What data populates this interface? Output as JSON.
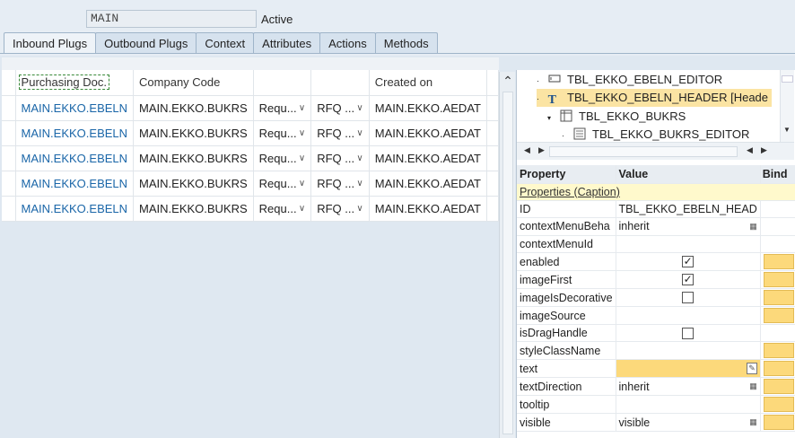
{
  "view": {
    "name": "MAIN",
    "status": "Active"
  },
  "tabs": [
    "Inbound Plugs",
    "Outbound Plugs",
    "Context",
    "Attributes",
    "Actions",
    "Methods"
  ],
  "grid": {
    "headers": [
      "Purchasing Doc.",
      "Company Code",
      "",
      "",
      "Created on"
    ],
    "rows": [
      [
        "MAIN.EKKO.EBELN",
        "MAIN.EKKO.BUKRS",
        "Requ...",
        "RFQ ...",
        "MAIN.EKKO.AEDAT"
      ],
      [
        "MAIN.EKKO.EBELN",
        "MAIN.EKKO.BUKRS",
        "Requ...",
        "RFQ ...",
        "MAIN.EKKO.AEDAT"
      ],
      [
        "MAIN.EKKO.EBELN",
        "MAIN.EKKO.BUKRS",
        "Requ...",
        "RFQ ...",
        "MAIN.EKKO.AEDAT"
      ],
      [
        "MAIN.EKKO.EBELN",
        "MAIN.EKKO.BUKRS",
        "Requ...",
        "RFQ ...",
        "MAIN.EKKO.AEDAT"
      ],
      [
        "MAIN.EKKO.EBELN",
        "MAIN.EKKO.BUKRS",
        "Requ...",
        "RFQ ...",
        "MAIN.EKKO.AEDAT"
      ]
    ]
  },
  "tree": {
    "nodes": [
      {
        "label": "TBL_EKKO_EBELN_EDITOR",
        "icon": "input-field-icon"
      },
      {
        "label": "TBL_EKKO_EBELN_HEADER  [Heade",
        "icon": "text-view-icon"
      },
      {
        "label": "TBL_EKKO_BUKRS",
        "icon": "table-column-icon"
      },
      {
        "label": "TBL_EKKO_BUKRS_EDITOR",
        "icon": "input-field-icon"
      }
    ]
  },
  "props": {
    "headers": {
      "property": "Property",
      "value": "Value",
      "bind": "Bind"
    },
    "group": "Properties (Caption)",
    "rows": [
      {
        "name": "ID",
        "value": "TBL_EKKO_EBELN_HEAD"
      },
      {
        "name": "contextMenuBeha",
        "value": "inherit"
      },
      {
        "name": "contextMenuId",
        "value": ""
      },
      {
        "name": "enabled",
        "value": "checked"
      },
      {
        "name": "imageFirst",
        "value": "checked"
      },
      {
        "name": "imageIsDecorative",
        "value": "unchecked"
      },
      {
        "name": "imageSource",
        "value": ""
      },
      {
        "name": "isDragHandle",
        "value": "unchecked"
      },
      {
        "name": "styleClassName",
        "value": ""
      },
      {
        "name": "text",
        "value": ""
      },
      {
        "name": "textDirection",
        "value": "inherit"
      },
      {
        "name": "tooltip",
        "value": ""
      },
      {
        "name": "visible",
        "value": "visible"
      }
    ]
  }
}
